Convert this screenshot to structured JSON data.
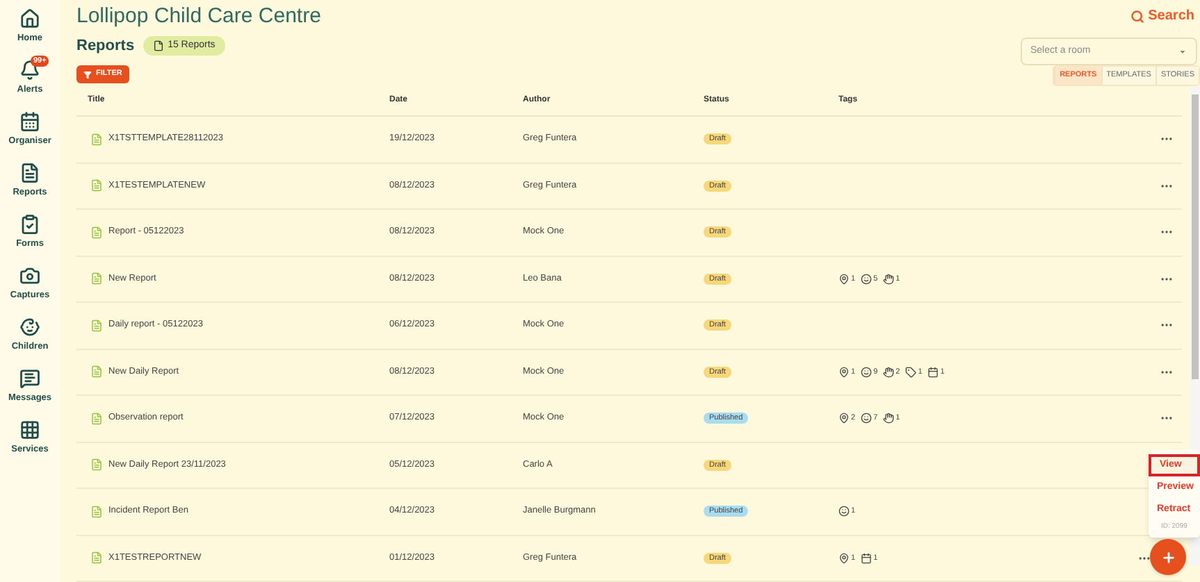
{
  "sidebar": {
    "items": [
      {
        "label": "Home",
        "kind": "home"
      },
      {
        "label": "Alerts",
        "kind": "bell",
        "badge": "99+"
      },
      {
        "label": "Organiser",
        "kind": "calendar"
      },
      {
        "label": "Reports",
        "kind": "file"
      },
      {
        "label": "Forms",
        "kind": "clipboard"
      },
      {
        "label": "Captures",
        "kind": "camera"
      },
      {
        "label": "Children",
        "kind": "child"
      },
      {
        "label": "Messages",
        "kind": "message"
      },
      {
        "label": "Services",
        "kind": "grid"
      }
    ]
  },
  "header": {
    "title": "Lollipop Child Care Centre",
    "search": "Search",
    "section": "Reports",
    "count_label": "15 Reports",
    "room_select": {
      "placeholder": "Select a room"
    },
    "filter": "FILTER"
  },
  "tabs": [
    {
      "label": "REPORTS",
      "selected": true
    },
    {
      "label": "TEMPLATES",
      "selected": false
    },
    {
      "label": "STORIES",
      "selected": false
    }
  ],
  "table": {
    "columns": [
      "Title",
      "Date",
      "Author",
      "Status",
      "Tags"
    ],
    "rows": [
      {
        "title": "X1TSTTEMPLATE28112023",
        "date": "19/12/2023",
        "author": "Greg Funtera",
        "status": "Draft",
        "tags": []
      },
      {
        "title": "X1TESTEMPLATENEW",
        "date": "08/12/2023",
        "author": "Greg Funtera",
        "status": "Draft",
        "tags": []
      },
      {
        "title": "Report - 05122023",
        "date": "08/12/2023",
        "author": "Mock One",
        "status": "Draft",
        "tags": []
      },
      {
        "title": "New Report",
        "date": "08/12/2023",
        "author": "Leo Bana",
        "status": "Draft",
        "tags": [
          {
            "kind": "location",
            "count": "1"
          },
          {
            "kind": "child",
            "count": "5"
          },
          {
            "kind": "educator",
            "count": "1"
          }
        ]
      },
      {
        "title": "Daily report - 05122023",
        "date": "06/12/2023",
        "author": "Mock One",
        "status": "Draft",
        "tags": []
      },
      {
        "title": "New Daily Report",
        "date": "08/12/2023",
        "author": "Mock One",
        "status": "Draft",
        "tags": [
          {
            "kind": "location",
            "count": "1"
          },
          {
            "kind": "child",
            "count": "9"
          },
          {
            "kind": "educator",
            "count": "2"
          },
          {
            "kind": "tag",
            "count": "1"
          },
          {
            "kind": "calendar",
            "count": "1"
          }
        ]
      },
      {
        "title": "Observation report",
        "date": "07/12/2023",
        "author": "Mock One",
        "status": "Published",
        "tags": [
          {
            "kind": "location",
            "count": "2"
          },
          {
            "kind": "child",
            "count": "7"
          },
          {
            "kind": "educator",
            "count": "1"
          }
        ]
      },
      {
        "title": "New Daily Report 23/11/2023",
        "date": "05/12/2023",
        "author": "Carlo A",
        "status": "Draft",
        "tags": []
      },
      {
        "title": "Incident Report Ben",
        "date": "04/12/2023",
        "author": "Janelle Burgmann",
        "status": "Published",
        "tags": [
          {
            "kind": "child",
            "count": "1"
          }
        ]
      },
      {
        "title": "X1TESTREPORTNEW",
        "date": "01/12/2023",
        "author": "Greg Funtera",
        "status": "Draft",
        "tags": [
          {
            "kind": "location",
            "count": "1"
          },
          {
            "kind": "calendar",
            "count": "1"
          }
        ]
      }
    ]
  },
  "context_menu": {
    "items": [
      {
        "label": "View",
        "selected": true
      },
      {
        "label": "Preview",
        "selected": false
      },
      {
        "label": "Retract",
        "selected": false
      }
    ],
    "id_label": "ID: 2099"
  }
}
